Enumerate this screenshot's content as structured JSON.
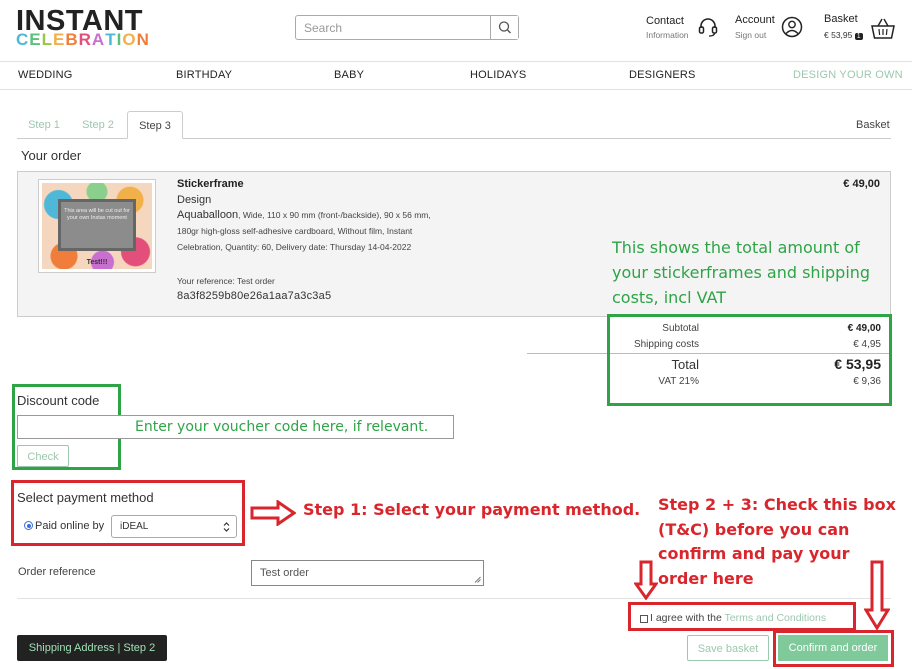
{
  "header": {
    "logo_top": "INSTANT",
    "logo_bottom": [
      "C",
      "E",
      "L",
      "E",
      "B",
      "R",
      "A",
      "T",
      "I",
      "O",
      "N"
    ],
    "logo_colors": [
      "#4fb8d8",
      "#5cbf7a",
      "#9bc44a",
      "#f2b04a",
      "#f07e3a",
      "#e14f7a",
      "#c86fd0",
      "#4fb8d8",
      "#5cbf7a",
      "#f2b04a",
      "#f07e3a"
    ],
    "search_placeholder": "Search",
    "contact_label": "Contact",
    "contact_sub": "Information",
    "account_label": "Account",
    "account_sub": "Sign out",
    "basket_label": "Basket",
    "basket_amount": "€ 53,95",
    "basket_count": "1"
  },
  "nav": {
    "wedding": "WEDDING",
    "birthday": "BIRTHDAY",
    "baby": "BABY",
    "holidays": "HOLIDAYS",
    "designers": "DESIGNERS",
    "design_your_own": "DESIGN YOUR OWN"
  },
  "tabs": {
    "step1": "Step 1",
    "step2": "Step 2",
    "step3": "Step 3",
    "basket": "Basket"
  },
  "order": {
    "heading": "Your order",
    "image_window_text": "This area will be cut out for your own Instax moment",
    "image_caption": "Test!!!",
    "product_name": "Stickerframe",
    "design_label": "Design",
    "design_name": "Aquaballoon",
    "details": ", Wide, 110 x 90 mm (front-/backside), 90 x 56 mm, 180gr high-gloss self-adhesive cardboard, Without film, Instant Celebration, Quantity: 60, Delivery date: Thursday 14-04-2022",
    "reference_line": "Your reference: Test order",
    "hash": "8a3f8259b80e26a1aa7a3c3a5",
    "price": "€ 49,00"
  },
  "totals": {
    "subtotal_label": "Subtotal",
    "subtotal_value": "€ 49,00",
    "shipping_label": "Shipping costs",
    "shipping_value": "€ 4,95",
    "total_label": "Total",
    "total_value": "€ 53,95",
    "vat_label": "VAT 21%",
    "vat_value": "€ 9,36"
  },
  "discount": {
    "label": "Discount code",
    "value": "",
    "check_button": "Check"
  },
  "payment": {
    "label": "Select payment method",
    "radio_label": "Paid online by",
    "selected": "iDEAL"
  },
  "reference": {
    "label": "Order reference",
    "value": "Test order"
  },
  "terms": {
    "prefix": "I agree with the ",
    "link": "Terms and Conditions"
  },
  "buttons": {
    "shipping": "Shipping Address | Step 2",
    "save": "Save basket",
    "confirm": "Confirm and order"
  },
  "annotations": {
    "totals_note": "This shows the total amount of your stickerframes and shipping costs, incl VAT",
    "voucher_note": "Enter your voucher code here, if relevant.",
    "step1_note": "Step 1: Select your payment method.",
    "step23_note": "Step 2 + 3: Check this box (T&C) before you can confirm and pay your order here"
  },
  "colors": {
    "accent_green": "#9cc8ae",
    "annotation_green": "#2ea447",
    "annotation_red": "#d8262c",
    "confirm_green": "#7fc99a"
  }
}
